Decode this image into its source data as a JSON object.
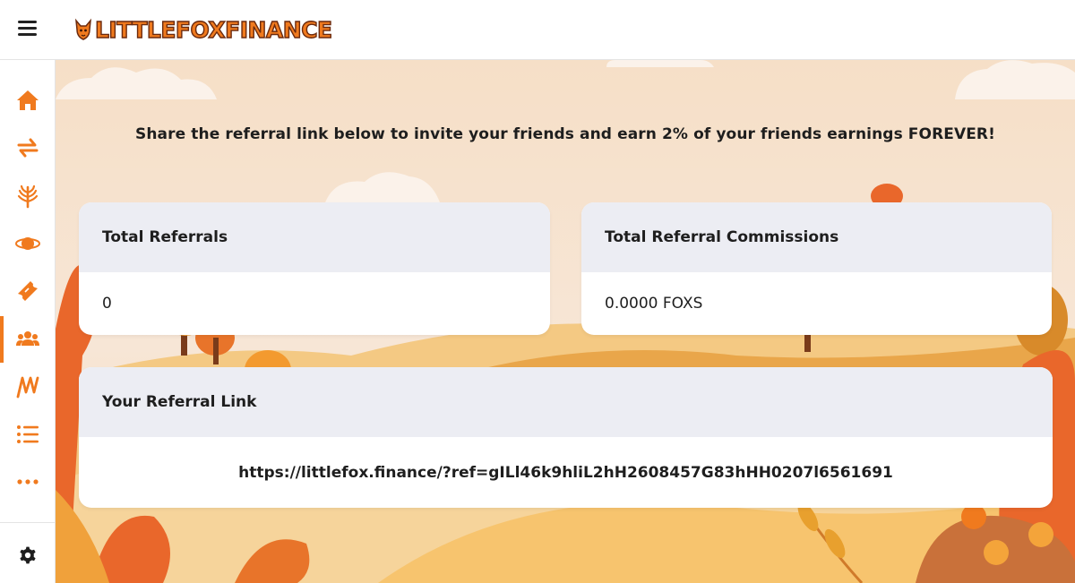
{
  "header": {
    "logo_text": "LITTLEFOXFINANCE",
    "menu_icon": "hamburger-menu-icon"
  },
  "sidebar": {
    "items": [
      {
        "name": "home",
        "icon": "home-icon",
        "active": false
      },
      {
        "name": "exchange",
        "icon": "swap-arrows-icon",
        "active": false
      },
      {
        "name": "farms",
        "icon": "wheat-icon",
        "active": false
      },
      {
        "name": "pools",
        "icon": "planet-icon",
        "active": false
      },
      {
        "name": "lottery",
        "icon": "ticket-icon",
        "active": false
      },
      {
        "name": "referrals",
        "icon": "users-group-icon",
        "active": true
      },
      {
        "name": "chart",
        "icon": "zigzag-chart-icon",
        "active": false
      },
      {
        "name": "list",
        "icon": "list-icon",
        "active": false
      },
      {
        "name": "more",
        "icon": "more-dots-icon",
        "active": false
      }
    ],
    "settings_icon": "gear-icon"
  },
  "main": {
    "intro": "Share the referral link below to invite your friends and earn 2% of your friends earnings FOREVER!",
    "total_referrals": {
      "title": "Total Referrals",
      "value": "0"
    },
    "total_commissions": {
      "title": "Total Referral Commissions",
      "value": "0.0000 FOXS"
    },
    "referral_link": {
      "title": "Your Referral Link",
      "value": "https://littlefox.finance/?ref=gILl46k9hliL2hH2608457G83hHH0207l6561691"
    }
  },
  "colors": {
    "accent": "#f07a1e",
    "card_header": "#ecedf3"
  }
}
